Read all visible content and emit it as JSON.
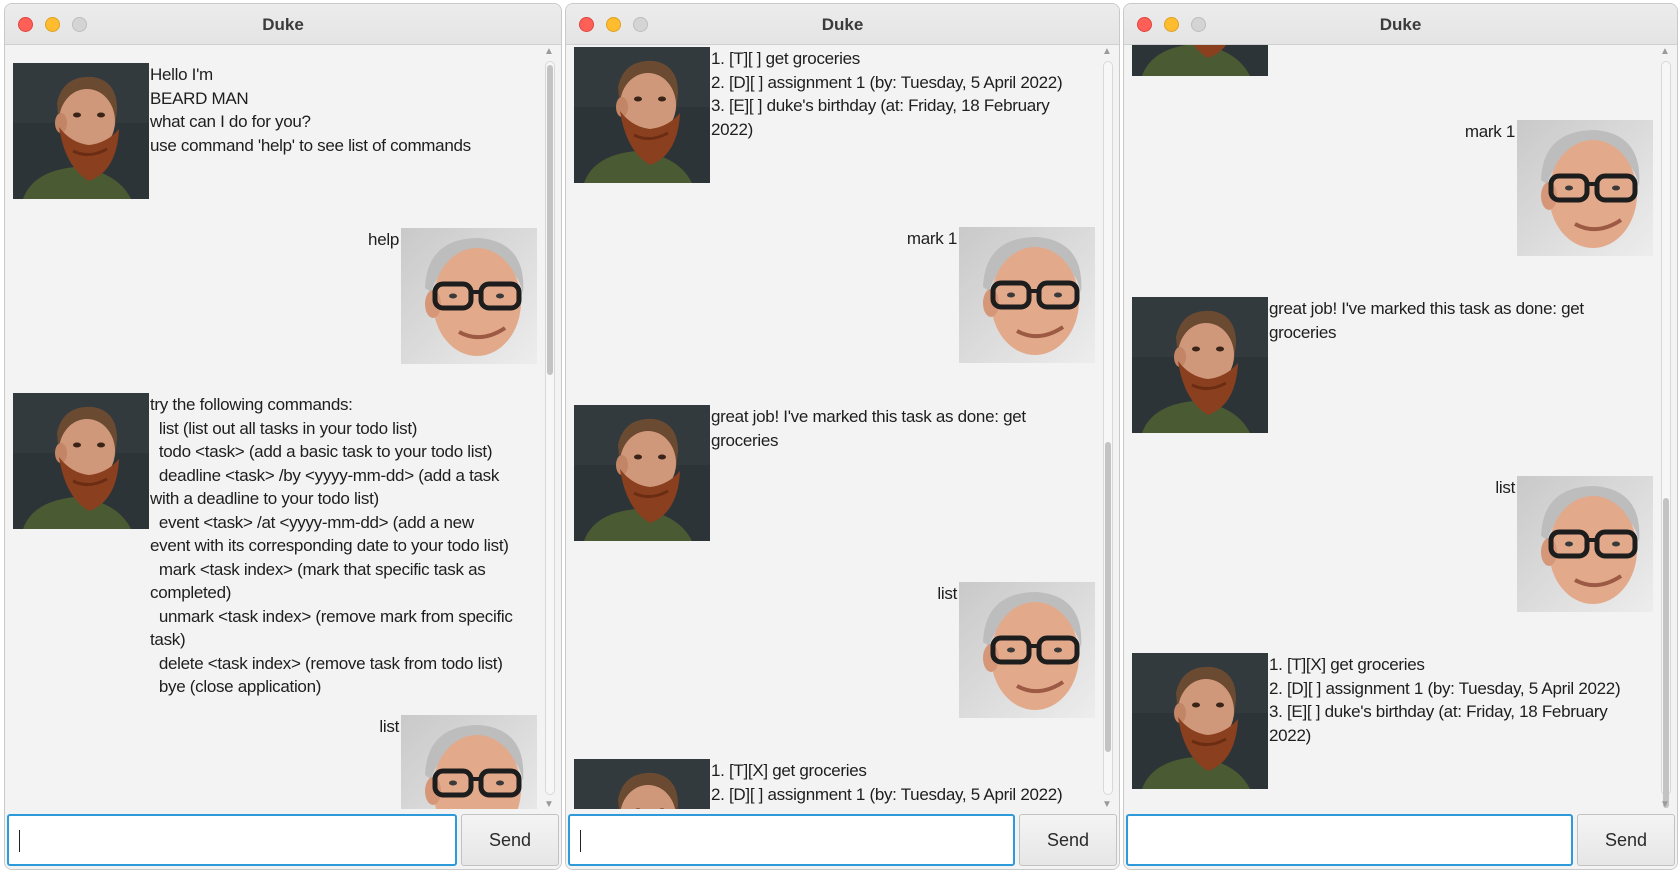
{
  "windows": [
    {
      "title": "Duke",
      "send_label": "Send",
      "input_value": "",
      "messages": [
        {
          "sender": "duke",
          "text": "Hello I'm\nBEARD MAN\nwhat can I do for you?\nuse command 'help' to see list of commands"
        },
        {
          "sender": "user",
          "text": "help"
        },
        {
          "sender": "duke",
          "text": "try the following commands:\n  list (list out all tasks in your todo list)\n  todo <task> (add a basic task to your todo list)\n  deadline <task> /by <yyyy-mm-dd> (add a task\nwith a deadline to your todo list)\n  event <task> /at <yyyy-mm-dd> (add a new\nevent with its corresponding date to your todo list)\n  mark <task index> (mark that specific task as\ncompleted)\n  unmark <task index> (remove mark from specific\ntask)\n  delete <task index> (remove task from todo list)\n  bye (close application)"
        },
        {
          "sender": "user",
          "text": "list"
        }
      ]
    },
    {
      "title": "Duke",
      "send_label": "Send",
      "input_value": "",
      "messages": [
        {
          "sender": "duke",
          "text": "1. [T][ ] get groceries\n2. [D][ ] assignment 1 (by: Tuesday, 5 April 2022)\n3. [E][ ] duke's birthday (at: Friday, 18 February\n2022)"
        },
        {
          "sender": "user",
          "text": "mark 1"
        },
        {
          "sender": "duke",
          "text": "great job! I've marked this task as done: get\ngroceries"
        },
        {
          "sender": "user",
          "text": "list"
        },
        {
          "sender": "duke",
          "text": "1. [T][X] get groceries\n2. [D][ ] assignment 1 (by: Tuesday, 5 April 2022)"
        }
      ]
    },
    {
      "title": "Duke",
      "send_label": "Send",
      "input_value": "",
      "messages": [
        {
          "sender": "duke",
          "text": ""
        },
        {
          "sender": "user",
          "text": "mark 1"
        },
        {
          "sender": "duke",
          "text": "great job! I've marked this task as done: get\ngroceries"
        },
        {
          "sender": "user",
          "text": "list"
        },
        {
          "sender": "duke",
          "text": "1. [T][X] get groceries\n2. [D][ ] assignment 1 (by: Tuesday, 5 April 2022)\n3. [E][ ] duke's birthday (at: Friday, 18 February\n2022)"
        }
      ]
    }
  ],
  "colors": {
    "window_bg": "#f3f3f3",
    "focus_ring": "#2f9ad9",
    "close": "#fe5f57",
    "minimize": "#febc2e",
    "zoom_disabled": "#d4d4d4"
  }
}
